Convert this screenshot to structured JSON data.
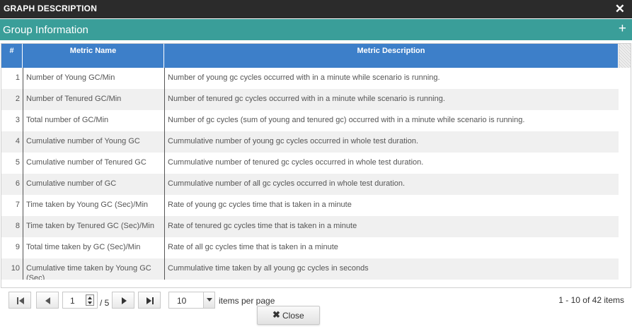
{
  "dialog": {
    "title": "GRAPH DESCRIPTION",
    "close_glyph": "✕",
    "close_icon": "close-icon"
  },
  "group": {
    "label": "Group Information",
    "expand_glyph": "+",
    "expand_icon": "plus-icon"
  },
  "table": {
    "columns": [
      "#",
      "Metric Name",
      "Metric Description"
    ],
    "rows": [
      {
        "num": "1",
        "name": "Number of Young GC/Min",
        "desc": "Number of young gc cycles occurred with in a minute while scenario is running."
      },
      {
        "num": "2",
        "name": "Number of Tenured GC/Min",
        "desc": "Number of tenured gc cycles occurred with in a minute while scenario is running."
      },
      {
        "num": "3",
        "name": "Total number of GC/Min",
        "desc": "Number of gc cycles (sum of young and tenured gc) occurred with in a minute while scenario is running."
      },
      {
        "num": "4",
        "name": "Cumulative number of Young GC",
        "desc": "Cummulative number of young gc cycles occurred in whole test duration."
      },
      {
        "num": "5",
        "name": "Cumulative number of Tenured GC",
        "desc": "Cummulative number of tenured gc cycles occurred in whole test duration."
      },
      {
        "num": "6",
        "name": "Cumulative number of GC",
        "desc": "Cummulative number of all gc cycles occurred in whole test duration."
      },
      {
        "num": "7",
        "name": "Time taken by Young GC (Sec)/Min",
        "desc": "Rate of young gc cycles time that is taken in a minute"
      },
      {
        "num": "8",
        "name": "Time taken by Tenured GC (Sec)/Min",
        "desc": "Rate of tenured gc cycles time that is taken in a minute"
      },
      {
        "num": "9",
        "name": "Total time taken by GC (Sec)/Min",
        "desc": "Rate of all gc cycles time that is taken in a minute"
      },
      {
        "num": "10",
        "name": "Cumulative time taken by Young GC (Sec)",
        "desc": "Cummulative time taken by all young gc cycles in seconds"
      }
    ]
  },
  "pager": {
    "current_page": "1",
    "of_total": "/ 5",
    "page_size": "10",
    "items_per_page_label": "items per page",
    "info": "1 - 10 of 42 items"
  },
  "footer": {
    "close_label": "Close",
    "close_glyph": "✖"
  },
  "colors": {
    "titlebar": "#2b2b2b",
    "group_header": "#3a9e99",
    "table_header": "#3d7fc9",
    "alt_row": "#f0f0f0"
  }
}
